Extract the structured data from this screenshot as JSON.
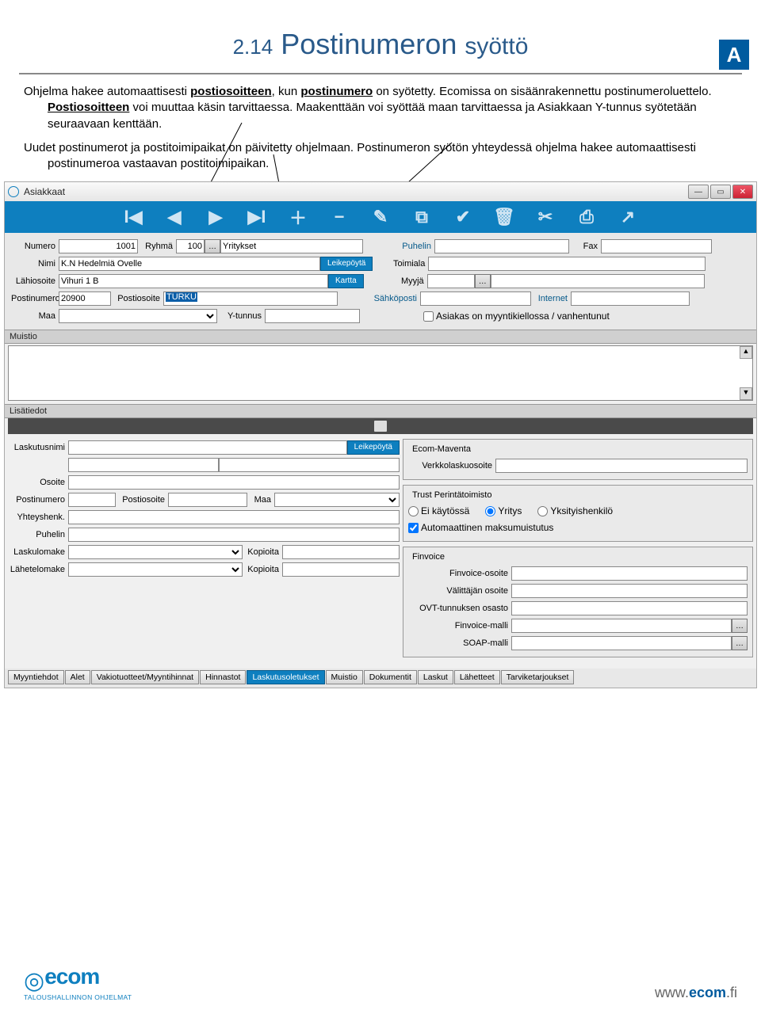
{
  "badge": "A",
  "title_num": "2.14",
  "title_main": "Postinumeron",
  "title_sub": "syöttö",
  "para1_a": "Ohjelma hakee automaattisesti ",
  "para1_u1": "postiosoitteen",
  "para1_b": ", kun ",
  "para1_u2": "postinumero",
  "para1_c": " on syötetty. Ecomissa on sisäänrakennettu postinumeroluettelo. ",
  "para1_u3": "Postiosoitteen",
  "para1_d": " voi muuttaa käsin tarvittaessa. Maakenttään voi syöttää maan tarvittaessa ja Asiakkaan Y-tunnus syötetään seuraavaan kenttään.",
  "para2": "Uudet postinumerot ja postitoimipaikat on päivitetty ohjelmaan. Postinumeron syötön yhteydessä ohjelma hakee automaattisesti postinumeroa vastaavan postitoimipaikan.",
  "win_title": "Asiakkaat",
  "form": {
    "numero_lbl": "Numero",
    "numero_val": "1001",
    "ryhma_lbl": "Ryhmä",
    "ryhma_val": "100",
    "ryhma_name": "Yritykset",
    "puhelin_lbl": "Puhelin",
    "fax_lbl": "Fax",
    "nimi_lbl": "Nimi",
    "nimi_val": "K.N Hedelmiä Ovelle",
    "toimiala_lbl": "Toimiala",
    "lahiosoite_lbl": "Lähiosoite",
    "lahiosoite_val": "Vihuri 1 B",
    "myyja_lbl": "Myyjä",
    "postinumero_lbl": "Postinumero",
    "postinumero_val": "20900",
    "postiosoite_lbl": "Postiosoite",
    "postiosoite_val": "TURKU",
    "sahkoposti_lbl": "Sähköposti",
    "internet_lbl": "Internet",
    "maa_lbl": "Maa",
    "ytunnus_lbl": "Y-tunnus",
    "kielto_lbl": "Asiakas on myyntikiellossa / vanhentunut",
    "leikepoyta_btn": "Leikepöytä",
    "kartta_btn": "Kartta"
  },
  "muistio_head": "Muistio",
  "lisatiedot_head": "Lisätiedot",
  "left": {
    "laskutusnimi_lbl": "Laskutusnimi",
    "osoite_lbl": "Osoite",
    "postinumero_lbl": "Postinumero",
    "postiosoite_lbl": "Postiosoite",
    "maa_lbl": "Maa",
    "yhteyshenk_lbl": "Yhteyshenk.",
    "puhelin_lbl": "Puhelin",
    "laskulomake_lbl": "Laskulomake",
    "lahetelomake_lbl": "Lähetelomake",
    "kopioita_lbl": "Kopioita",
    "leikepoyta_btn": "Leikepöytä"
  },
  "right": {
    "ecom_leg": "Ecom-Maventa",
    "verkko_lbl": "Verkkolaskuosoite",
    "trust_leg": "Trust Perintätoimisto",
    "ei_lbl": "Ei käytössä",
    "yritys_lbl": "Yritys",
    "yks_lbl": "Yksityishenkilö",
    "auto_lbl": "Automaattinen maksumuistutus",
    "finvoice_leg": "Finvoice",
    "finv_os_lbl": "Finvoice-osoite",
    "val_os_lbl": "Välittäjän osoite",
    "ovt_lbl": "OVT-tunnuksen osasto",
    "finv_malli_lbl": "Finvoice-malli",
    "soap_lbl": "SOAP-malli"
  },
  "tabs": [
    "Myyntiehdot",
    "Alet",
    "Vakiotuotteet/Myyntihinnat",
    "Hinnastot",
    "Laskutusoletukset",
    "Muistio",
    "Dokumentit",
    "Laskut",
    "Lähetteet",
    "Tarviketarjoukset"
  ],
  "tab_active_index": 4,
  "footer": {
    "brand": "ecom",
    "sub": "TALOUSHALLINNON OHJELMAT",
    "url_pre": "www.",
    "url_main": "ecom",
    "url_post": ".fi"
  }
}
